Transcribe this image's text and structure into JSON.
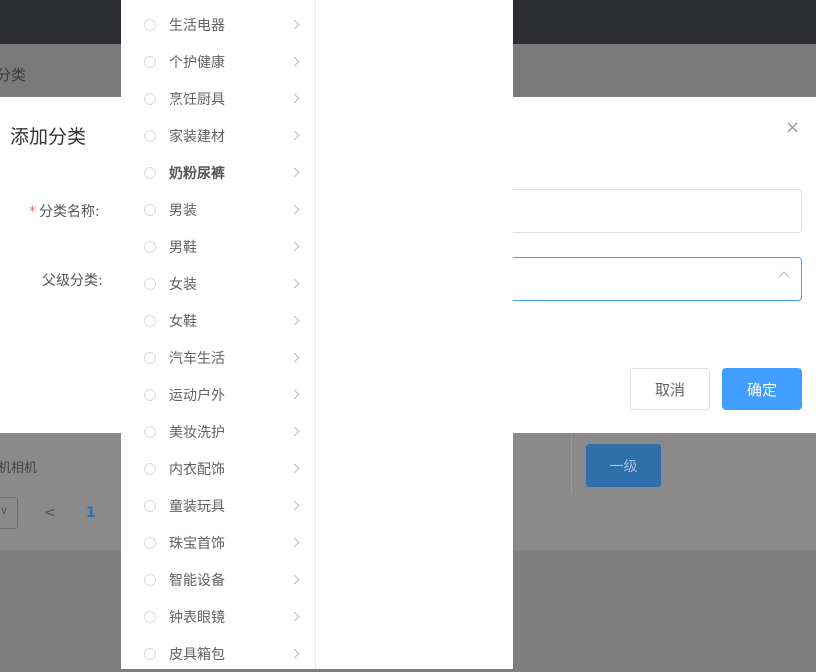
{
  "background": {
    "breadcrumb": "分类",
    "row_text": "机相机",
    "level_button": "一级",
    "pager_prev": "<",
    "pager_current": "1",
    "pager_caret": "∨"
  },
  "dialog": {
    "title": "添加分类",
    "close_icon": "×",
    "name_label": "分类名称:",
    "name_required_mark": "*",
    "name_value": "",
    "parent_label": "父级分类:",
    "parent_value": "",
    "cancel_label": "取消",
    "confirm_label": "确定"
  },
  "cascader": {
    "options": [
      {
        "label": "生活电器"
      },
      {
        "label": "个护健康"
      },
      {
        "label": "烹饪厨具"
      },
      {
        "label": "家装建材"
      },
      {
        "label": "奶粉尿裤",
        "highlighted": true
      },
      {
        "label": "男装"
      },
      {
        "label": "男鞋"
      },
      {
        "label": "女装"
      },
      {
        "label": "女鞋"
      },
      {
        "label": "汽车生活"
      },
      {
        "label": "运动户外"
      },
      {
        "label": "美妆洗护"
      },
      {
        "label": "内衣配饰"
      },
      {
        "label": "童装玩具"
      },
      {
        "label": "珠宝首饰"
      },
      {
        "label": "智能设备"
      },
      {
        "label": "钟表眼镜"
      },
      {
        "label": "皮具箱包"
      }
    ]
  },
  "colors": {
    "primary": "#409eff",
    "required": "#f56c6c",
    "topbar": "#2b2d30"
  }
}
